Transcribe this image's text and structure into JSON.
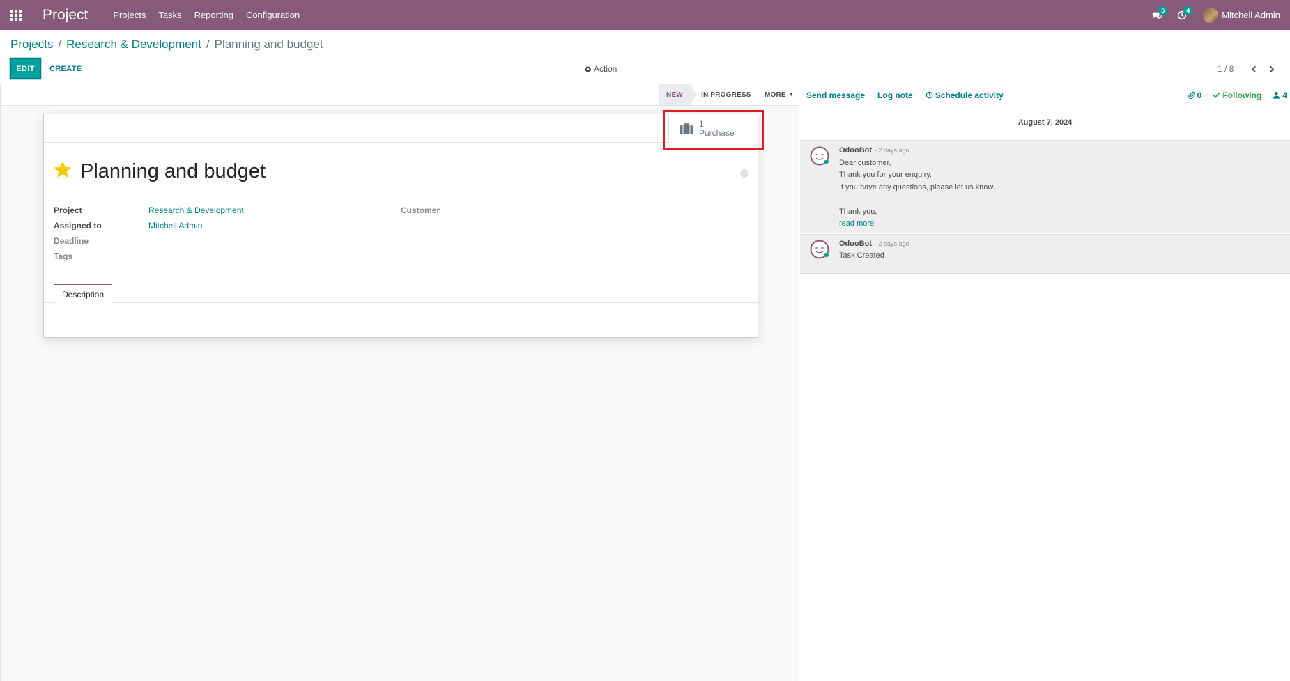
{
  "navbar": {
    "app_name": "Project",
    "menu": [
      "Projects",
      "Tasks",
      "Reporting",
      "Configuration"
    ],
    "messages_count": "5",
    "activities_count": "4",
    "user_name": "Mitchell Admin"
  },
  "breadcrumb": {
    "root": "Projects",
    "parent": "Research & Development",
    "separator": "/",
    "current": "Planning and budget"
  },
  "toolbar": {
    "edit_label": "EDIT",
    "create_label": "CREATE",
    "action_label": "Action",
    "pager": "1 / 8"
  },
  "statusbar": {
    "stage_new": "NEW",
    "stage_in_progress": "IN PROGRESS",
    "more_label": "MORE"
  },
  "form": {
    "stat_button": {
      "count": "1",
      "label": "Purchase"
    },
    "title": "Planning and budget",
    "fields": {
      "project_label": "Project",
      "project_value": "Research & Development",
      "assigned_label": "Assigned to",
      "assigned_value": "Mitchell Admin",
      "deadline_label": "Deadline",
      "tags_label": "Tags",
      "customer_label": "Customer"
    },
    "tabs": {
      "description": "Description"
    }
  },
  "chatter": {
    "send_message": "Send message",
    "log_note": "Log note",
    "schedule_activity": "Schedule activity",
    "attachments_count": "0",
    "following": "Following",
    "followers_count": "4",
    "date": "August 7, 2024",
    "messages": [
      {
        "author": "OdooBot",
        "date": "- 2 days ago",
        "lines": [
          "Dear customer,",
          "Thank you for your enquiry.",
          "If you have any questions, please let us know.",
          "Thank you,"
        ],
        "read_more": "read more"
      },
      {
        "author": "OdooBot",
        "date": "- 2 days ago",
        "lines": [
          "Task Created"
        ]
      }
    ]
  },
  "colors": {
    "brand": "#875a7b",
    "accent": "#017e84",
    "primary_button": "#00a09d",
    "highlight": "#e01b24",
    "star": "#f3cc00",
    "following": "#28a745"
  },
  "icons": {
    "apps": "apps-grid-icon",
    "messages": "comments-icon",
    "activities": "clock-icon",
    "action": "gear-icon",
    "pager_prev": "chevron-left-icon",
    "pager_next": "chevron-right-icon",
    "stat": "briefcase-icon",
    "priority": "star-icon",
    "attachments": "paperclip-icon",
    "following": "check-icon",
    "followers": "user-icon",
    "schedule": "clock-icon",
    "bot_avatar": "odoobot-avatar-icon"
  }
}
